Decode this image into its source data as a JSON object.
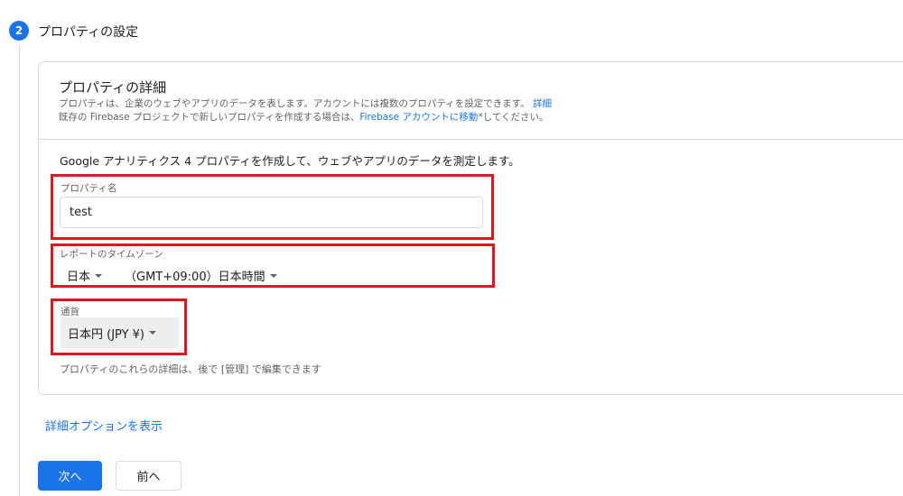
{
  "step": {
    "number": "2",
    "title": "プロパティの設定"
  },
  "card": {
    "title": "プロパティの詳細",
    "desc_line1": "プロパティは、企業のウェブやアプリのデータを表します。アカウントには複数のプロパティを設定できます。",
    "desc_line1_link": "詳細",
    "desc_line2_pre": "既存の Firebase プロジェクトで新しいプロパティを作成する場合は、",
    "desc_line2_link": "Firebase アカウントに移動",
    "desc_line2_post": "*してください。",
    "intro": "Google アナリティクス 4 プロパティを作成して、ウェブやアプリのデータを測定します。"
  },
  "property_name": {
    "label": "プロパティ名",
    "value": "test"
  },
  "timezone": {
    "label": "レポートのタイムゾーン",
    "country": "日本",
    "zone": "（GMT+09:00）日本時間"
  },
  "currency": {
    "label": "通貨",
    "value": "日本円 (JPY ¥)"
  },
  "note": "プロパティのこれらの詳細は、後で [管理] で編集できます",
  "advanced_link": "詳細オプションを表示",
  "buttons": {
    "next": "次へ",
    "back": "前へ"
  },
  "colors": {
    "accent": "#1a73e8",
    "highlight": "#e0161f"
  }
}
